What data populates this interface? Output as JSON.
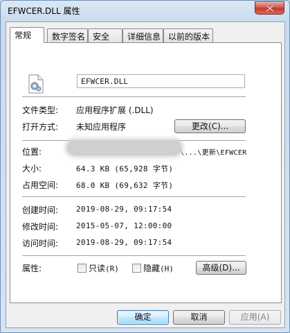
{
  "window": {
    "title": "EFWCER.DLL 属性"
  },
  "tabs": [
    {
      "label": "常规"
    },
    {
      "label": "数字签名"
    },
    {
      "label": "安全"
    },
    {
      "label": "详细信息"
    },
    {
      "label": "以前的版本"
    }
  ],
  "file": {
    "name": "EFWCER.DLL"
  },
  "info": {
    "type_label": "文件类型:",
    "type_value": "应用程序扩展 (.DLL)",
    "open_label": "打开方式:",
    "open_value": "未知应用程序",
    "change_button": "更改(C)...",
    "location_label": "位置:",
    "location_value": "\\...\\更新\\EFWCER",
    "size_label": "大小:",
    "size_value": "64.3 KB (65,928 字节)",
    "disk_label": "占用空间:",
    "disk_value": "68.0 KB (69,632 字节)",
    "created_label": "创建时间:",
    "created_value": "2019-08-29, 09:17:54",
    "modified_label": "修改时间:",
    "modified_value": "2015-05-07, 12:00:00",
    "accessed_label": "访问时间:",
    "accessed_value": "2019-08-29, 09:17:54",
    "attr_label": "属性:",
    "readonly_label": "只读",
    "readonly_key": "(R)",
    "hidden_label": "隐藏",
    "hidden_key": "(H)",
    "advanced_button": "高级(D)..."
  },
  "footer": {
    "ok": "确定",
    "cancel": "取消",
    "apply": "应用(A)"
  }
}
